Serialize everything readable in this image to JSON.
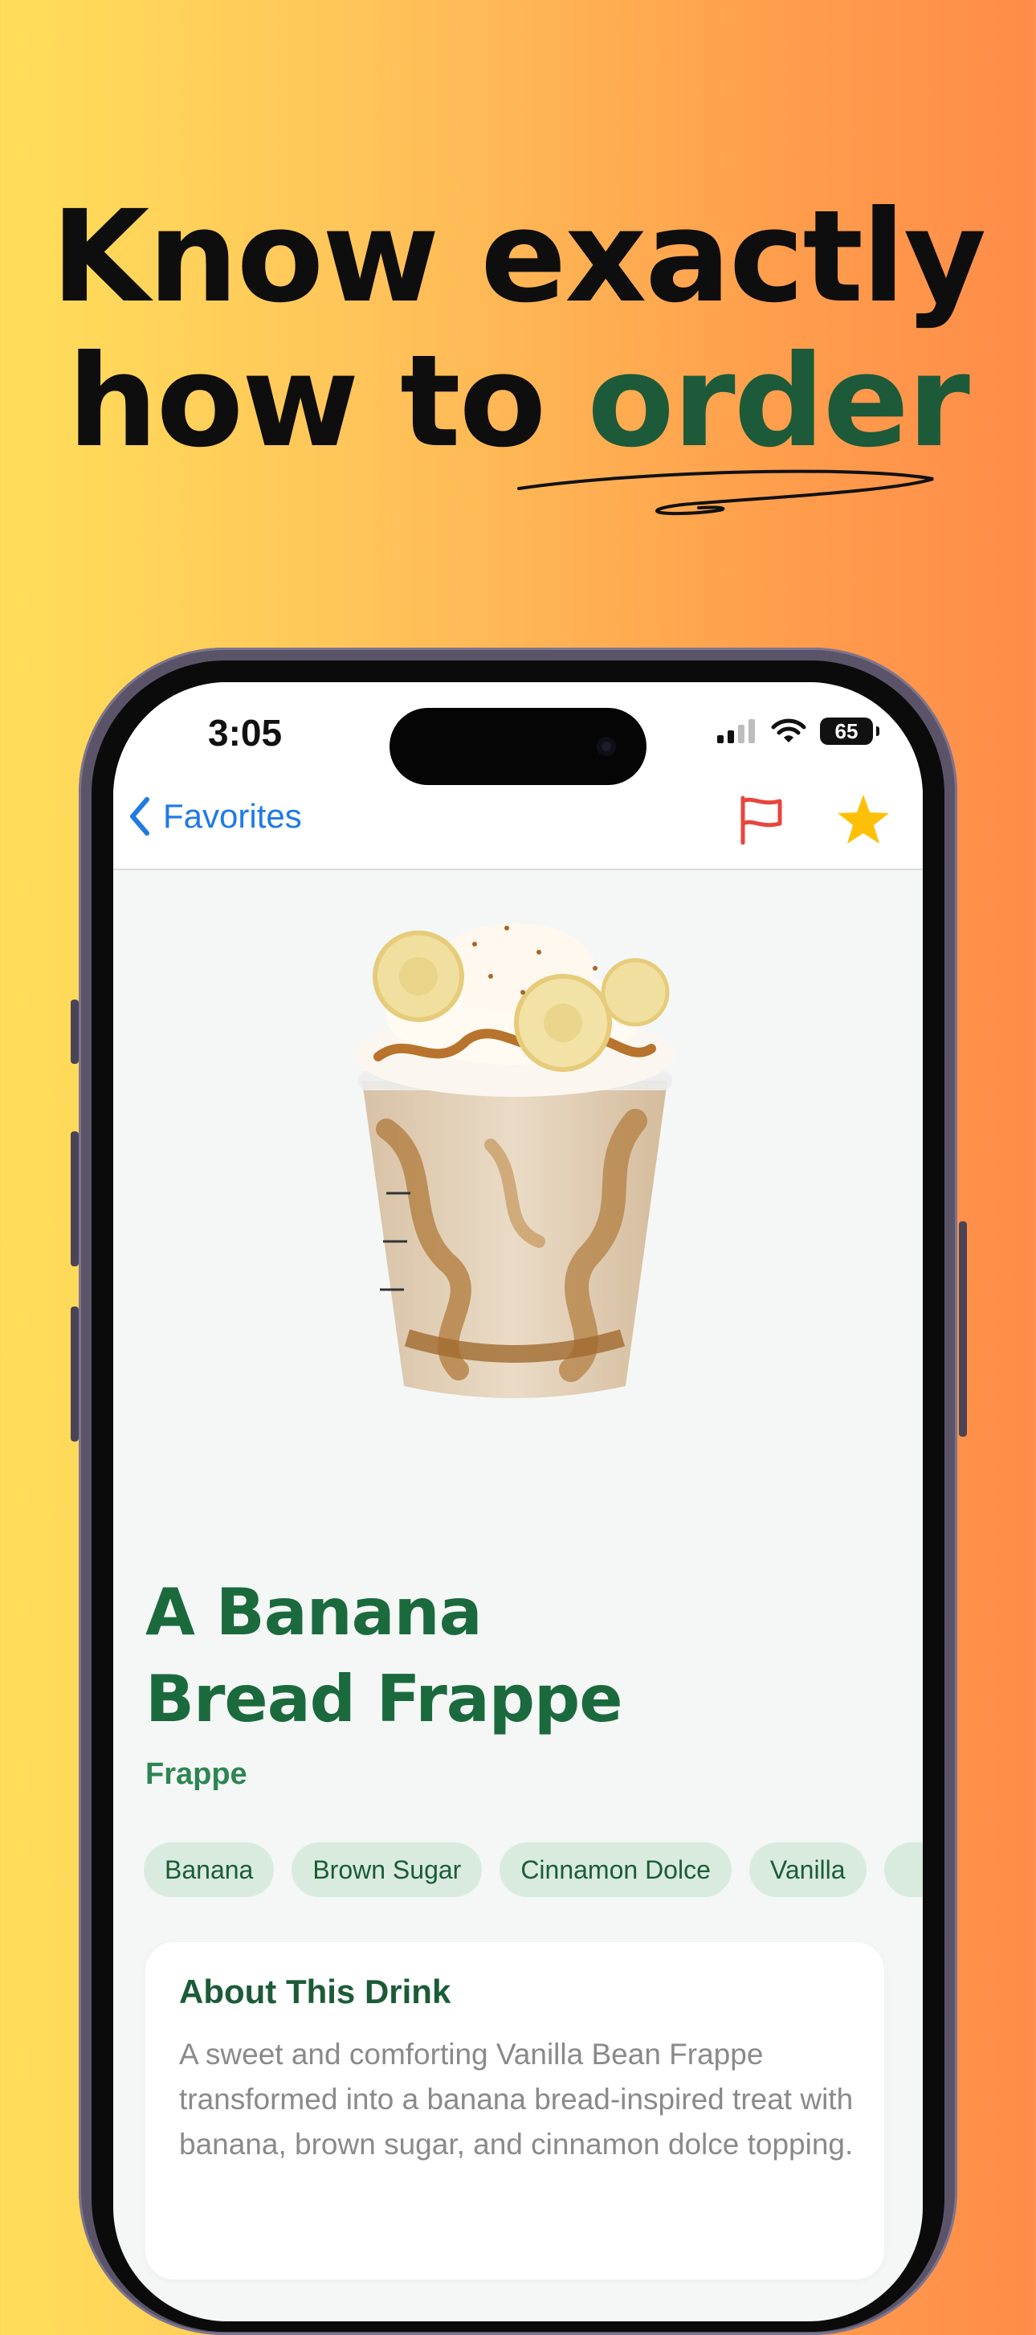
{
  "headline": {
    "line1": "Know exactly",
    "line2_prefix": "how to ",
    "line2_accent": "order"
  },
  "colors": {
    "accent_green": "#1D5A3A",
    "link_blue": "#1F7AE6",
    "flag_red": "#E8453C",
    "star_yellow": "#FFC107",
    "tag_bg": "#D9EBDF"
  },
  "status_bar": {
    "time": "3:05",
    "battery": "65",
    "icons": [
      "cellular-signal-icon",
      "wifi-icon",
      "battery-icon"
    ]
  },
  "nav": {
    "back_label": "Favorites",
    "icons": [
      "chevron-left-icon",
      "flag-icon",
      "star-icon"
    ]
  },
  "drink": {
    "title_line1": "A Banana",
    "title_line2": "Bread Frappe",
    "category": "Frappe",
    "tags": [
      "Banana",
      "Brown Sugar",
      "Cinnamon Dolce",
      "Vanilla"
    ]
  },
  "about": {
    "heading": "About This Drink",
    "body": "A sweet and comforting Vanilla Bean Frappe transformed into a banana bread-inspired treat with banana, brown sugar, and cinnamon dolce topping."
  }
}
